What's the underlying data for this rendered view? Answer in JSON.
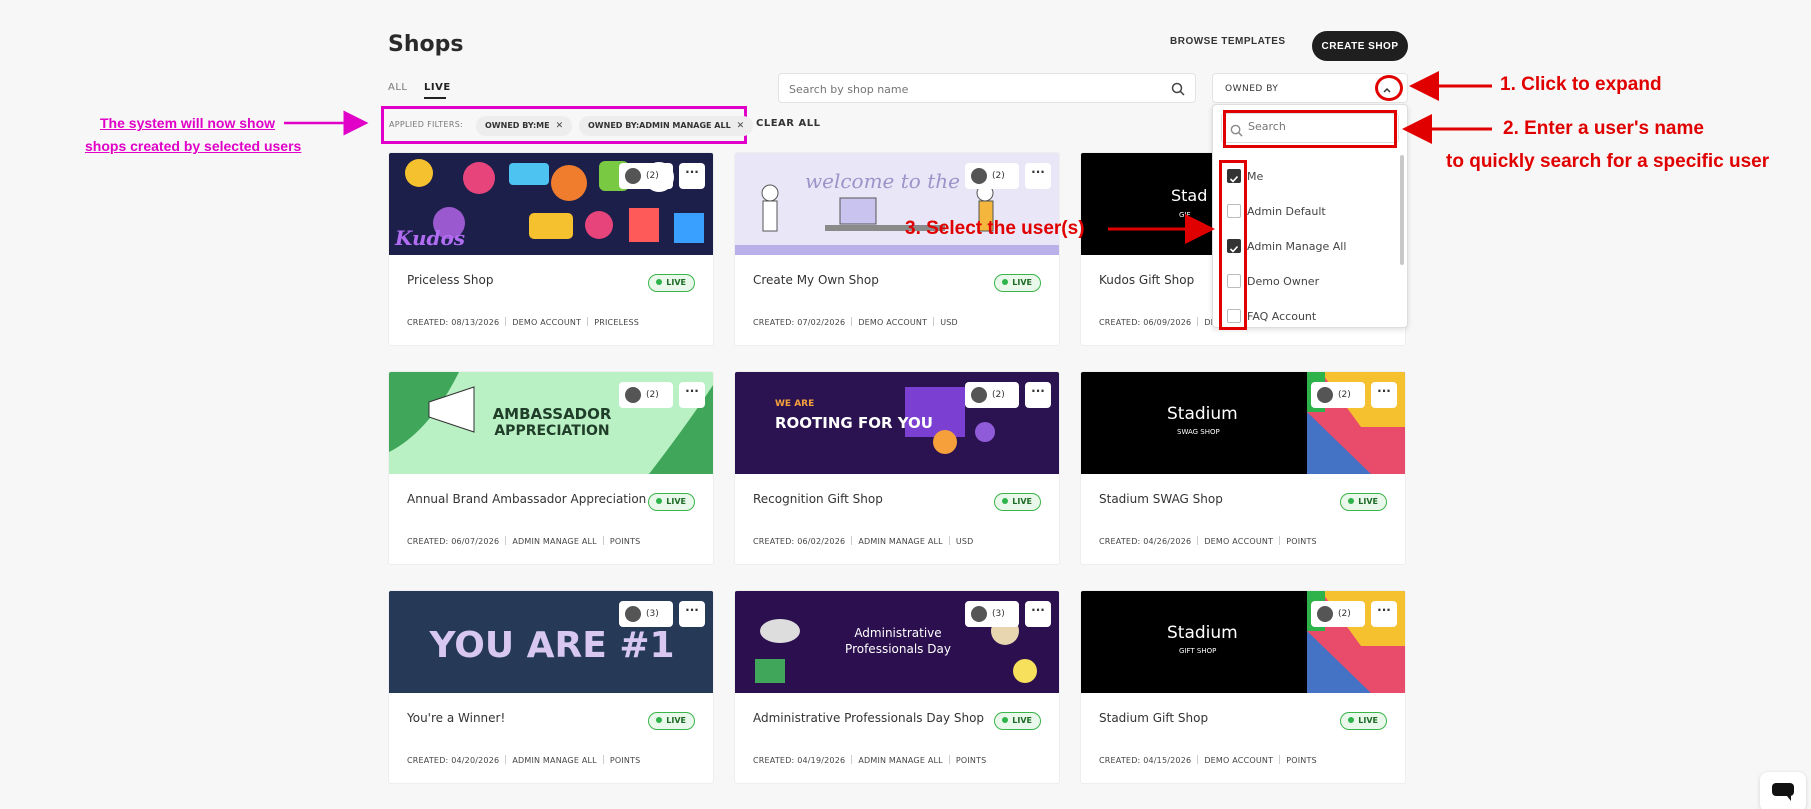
{
  "header": {
    "title": "Shops",
    "browse_templates": "BROWSE TEMPLATES",
    "create_shop": "CREATE SHOP"
  },
  "tabs": [
    {
      "label": "ALL",
      "active": false
    },
    {
      "label": "LIVE",
      "active": true
    }
  ],
  "search": {
    "placeholder": "Search by shop name"
  },
  "owned_by": {
    "label": "OWNED BY"
  },
  "filters": {
    "label": "APPLIED FILTERS:",
    "chips": [
      "OWNED BY:ME",
      "OWNED BY:ADMIN MANAGE ALL"
    ],
    "clear_all": "CLEAR ALL"
  },
  "dropdown": {
    "search_placeholder": "Search",
    "options": [
      {
        "label": "Me",
        "checked": true
      },
      {
        "label": "Admin Default",
        "checked": false
      },
      {
        "label": "Admin Manage All",
        "checked": true
      },
      {
        "label": "Demo Owner",
        "checked": false
      },
      {
        "label": "FAQ Account",
        "checked": false
      }
    ]
  },
  "live_label": "LIVE",
  "shops": [
    {
      "name": "Priceless Shop",
      "created": "CREATED: 08/13/2026",
      "owner": "DEMO ACCOUNT",
      "currency": "PRICELESS",
      "owners_count": "(2)"
    },
    {
      "name": "Create My Own Shop",
      "created": "CREATED: 07/02/2026",
      "owner": "DEMO ACCOUNT",
      "currency": "USD",
      "owners_count": "(2)",
      "banner_text": "welcome to the tea"
    },
    {
      "name": "Kudos Gift Shop",
      "created": "CREATED: 06/09/2026",
      "owner": "DE",
      "currency": "",
      "owners_count": "",
      "banner_text": "Stad",
      "banner_sub": "GIF"
    },
    {
      "name": "Annual Brand Ambassador Appreciation",
      "created": "CREATED: 06/07/2026",
      "owner": "ADMIN MANAGE ALL",
      "currency": "POINTS",
      "owners_count": "(2)",
      "banner_text": "AMBASSADOR",
      "banner_sub": "APPRECIATION"
    },
    {
      "name": "Recognition Gift Shop",
      "created": "CREATED: 06/02/2026",
      "owner": "ADMIN MANAGE ALL",
      "currency": "USD",
      "owners_count": "(2)",
      "banner_text": "WE ARE",
      "banner_sub": "ROOTING FOR YOU"
    },
    {
      "name": "Stadium SWAG Shop",
      "created": "CREATED: 04/26/2026",
      "owner": "DEMO ACCOUNT",
      "currency": "POINTS",
      "owners_count": "(2)",
      "banner_text": "Stadium",
      "banner_sub": "SWAG SHOP"
    },
    {
      "name": "You're a Winner!",
      "created": "CREATED: 04/20/2026",
      "owner": "ADMIN MANAGE ALL",
      "currency": "POINTS",
      "owners_count": "(3)",
      "banner_text": "YOU ARE #1"
    },
    {
      "name": "Administrative Professionals Day Shop",
      "created": "CREATED: 04/19/2026",
      "owner": "ADMIN MANAGE ALL",
      "currency": "POINTS",
      "owners_count": "(3)",
      "banner_text": "Administrative",
      "banner_sub": "Professionals Day"
    },
    {
      "name": "Stadium Gift Shop",
      "created": "CREATED: 04/15/2026",
      "owner": "DEMO ACCOUNT",
      "currency": "POINTS",
      "owners_count": "(2)",
      "banner_text": "Stadium",
      "banner_sub": "GIFT SHOP"
    }
  ],
  "annotations": {
    "step1": "1. Click to expand",
    "step2": "2. Enter a user's name",
    "step2b": "to quickly search for a specific user",
    "step3": "3. Select the user(s)",
    "note_line1": "The system will now show",
    "note_line2": "shops created by selected users"
  },
  "colors": {
    "annotation_red": "#e00000",
    "annotation_magenta": "#e000c8",
    "live_green": "#2db34a",
    "dark_button": "#1f1f1f"
  }
}
